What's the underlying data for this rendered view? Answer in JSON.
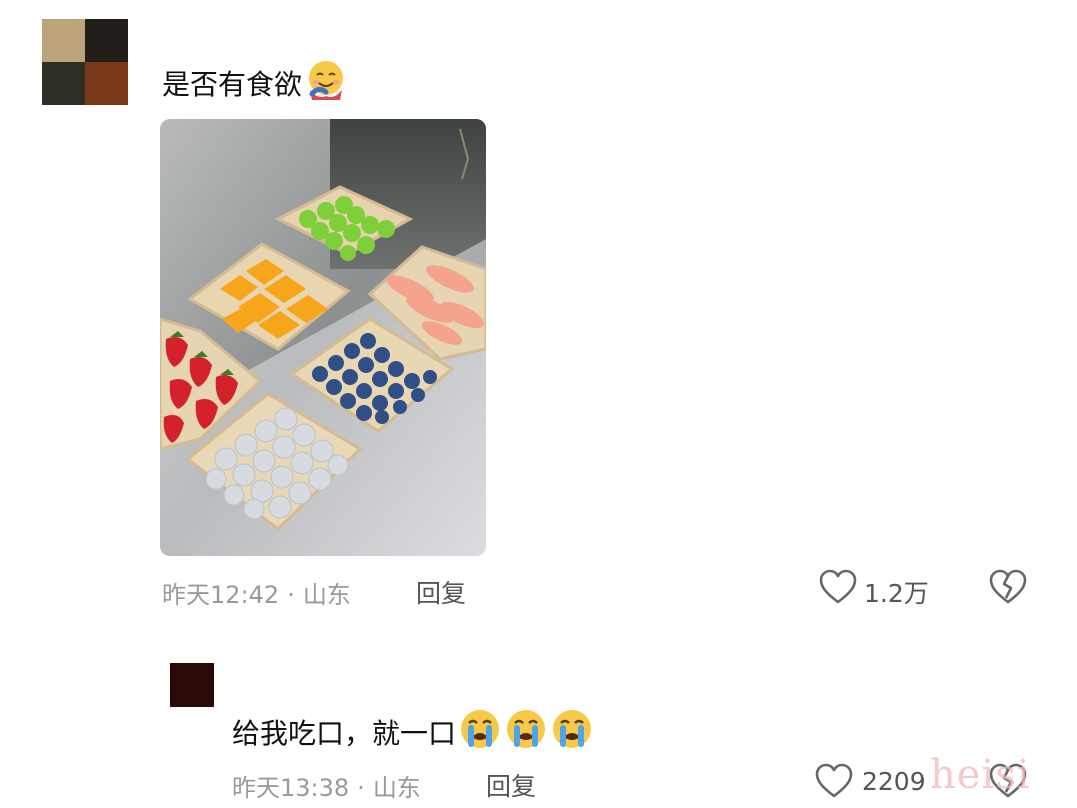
{
  "comments": [
    {
      "text": "是否有食欲",
      "emoji": "smiling-face-with-hearts-hug",
      "time": "昨天12:42",
      "location": "山东",
      "reply_label": "回复",
      "likes": "1.2万"
    },
    {
      "text": "给我吃口，就一口",
      "emoji": "loudly-crying-face",
      "emoji_count": 3,
      "time": "昨天13:38",
      "location": "山东",
      "reply_label": "回复",
      "likes": "2209"
    }
  ],
  "separator": "·",
  "watermark": "heisi",
  "colors": {
    "meta": "#9a9a9a",
    "icon": "#666666"
  }
}
